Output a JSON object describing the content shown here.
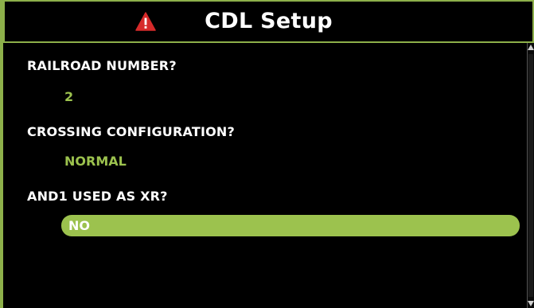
{
  "header": {
    "title": "CDL Setup",
    "warning_icon": "warning-triangle-icon",
    "warning_color": "#d62a2a"
  },
  "colors": {
    "accent": "#9cc24e",
    "border": "#8db04a",
    "background": "#000000",
    "text": "#ffffff"
  },
  "fields": [
    {
      "label": "RAILROAD NUMBER?",
      "value": "2"
    },
    {
      "label": "CROSSING CONFIGURATION?",
      "value": "NORMAL"
    },
    {
      "label": "AND1 USED AS XR?",
      "value": "NO",
      "selected": true
    }
  ],
  "scrollbar": {
    "up_icon": "scroll-up-arrow-icon",
    "down_icon": "scroll-down-arrow-icon"
  }
}
